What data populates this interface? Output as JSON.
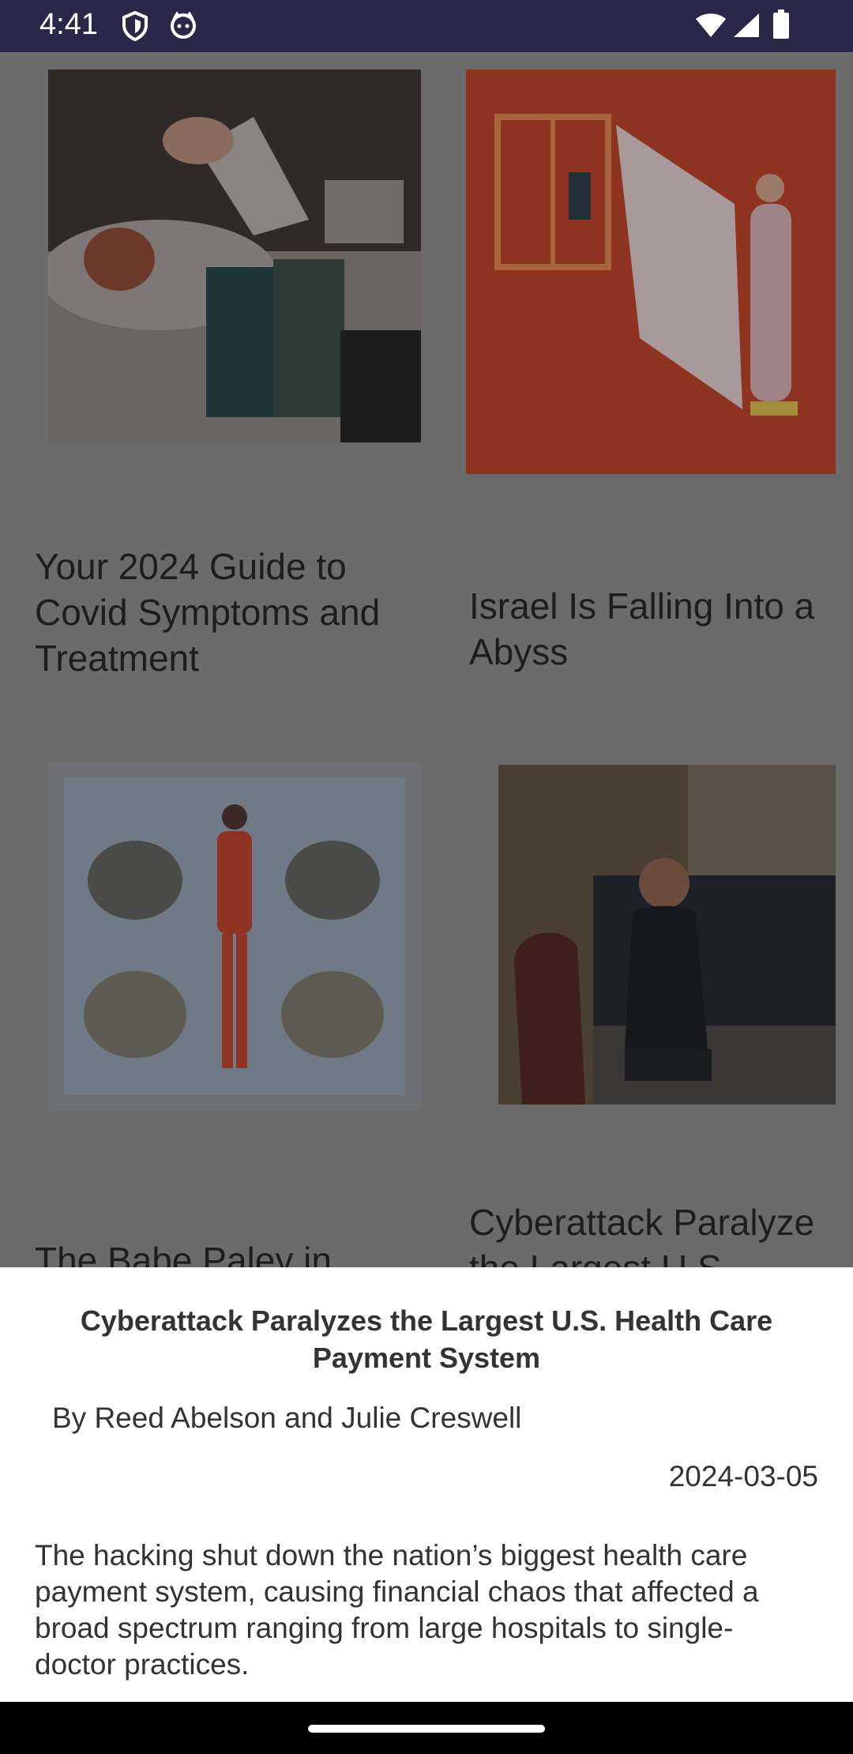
{
  "status_bar": {
    "time": "4:41",
    "icons_left": [
      "shield-icon",
      "cat-face-icon"
    ],
    "icons_right": [
      "wifi-icon",
      "signal-icon",
      "battery-icon"
    ]
  },
  "feed": {
    "cards": [
      {
        "title": "Your 2024 Guide to\nCovid Symptoms and\nTreatment",
        "image": "person-sick-with-tissues"
      },
      {
        "title": "Israel Is Falling Into a\nAbyss",
        "image": "illustration-red-window"
      },
      {
        "title": "The Babe Paley in",
        "image": "illustration-woman-with-geese"
      },
      {
        "title": "Cyberattack Paralyze\nthe Largest U.S.",
        "image": "photo-woman-seated-office"
      }
    ]
  },
  "sheet": {
    "title": "Cyberattack Paralyzes the Largest U.S. Health Care Payment System",
    "byline": "By Reed Abelson and Julie Creswell",
    "date": "2024-03-05",
    "summary": "The hacking shut down the nation’s biggest health care payment system, causing financial chaos that affected a broad spectrum ranging from large hospitals to single-doctor practices."
  },
  "colors": {
    "status_bar": "#2b2748",
    "scrim": "#6b6b6b",
    "sheet_bg": "#ffffff",
    "text": "#333333"
  }
}
